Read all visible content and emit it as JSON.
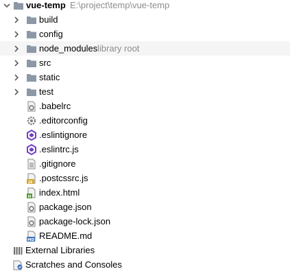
{
  "project_tree": {
    "root": {
      "name": "vue-temp",
      "path": "E:\\project\\temp\\vue-temp"
    },
    "folders": [
      {
        "name": "build"
      },
      {
        "name": "config"
      },
      {
        "name": "node_modules",
        "hint": "library root"
      },
      {
        "name": "src"
      },
      {
        "name": "static"
      },
      {
        "name": "test"
      }
    ],
    "files": [
      {
        "name": ".babelrc",
        "icon": "config-file-icon"
      },
      {
        "name": ".editorconfig",
        "icon": "gear-icon"
      },
      {
        "name": ".eslintignore",
        "icon": "eslint-icon"
      },
      {
        "name": ".eslintrc.js",
        "icon": "eslint-icon"
      },
      {
        "name": ".gitignore",
        "icon": "text-file-icon"
      },
      {
        "name": ".postcssrc.js",
        "icon": "js-file-icon",
        "badge": "JS"
      },
      {
        "name": "index.html",
        "icon": "html-file-icon",
        "badge": "H"
      },
      {
        "name": "package.json",
        "icon": "config-file-icon"
      },
      {
        "name": "package-lock.json",
        "icon": "config-file-icon"
      },
      {
        "name": "README.md",
        "icon": "markdown-file-icon",
        "badge": "MD"
      }
    ],
    "external_libraries": "External Libraries",
    "scratches": "Scratches and Consoles"
  },
  "colors": {
    "folder": "#8c98a6",
    "folder_open": "#8c98a6",
    "arrow": "#5c5c5c",
    "hint": "#8c8c8c",
    "eslint": "#7040c8",
    "js_badge": "#d7a72b",
    "html_badge": "#4b9e2f",
    "md_badge": "#3f73c0",
    "selection": "#f5f5f5"
  }
}
